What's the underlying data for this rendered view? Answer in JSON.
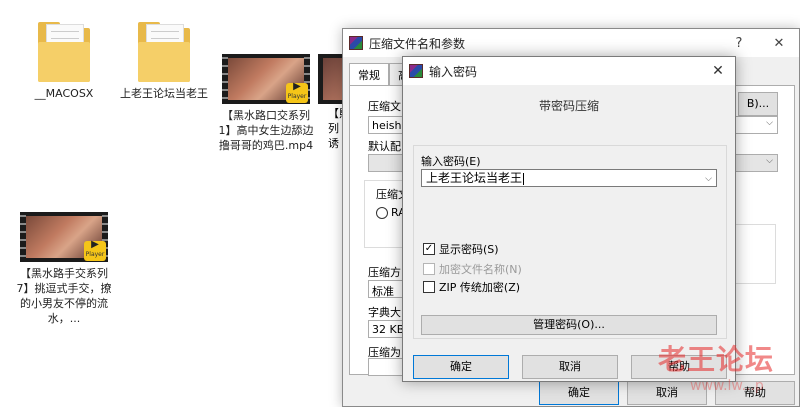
{
  "desktop": {
    "files": [
      {
        "type": "folder",
        "label": "__MACOSX"
      },
      {
        "type": "folder",
        "label": "上老王论坛当老王"
      },
      {
        "type": "video",
        "label": "【黑水路口交系列1】高中女生边舔边撸哥哥的鸡巴.mp4"
      },
      {
        "type": "video",
        "label": "【黑水路手交系列7】挑逗式手交，撩的小男友不停的流水，..."
      }
    ],
    "badge_text": "Player",
    "partial_labels": [
      "【熙",
      "列",
      "诱"
    ]
  },
  "archive_dialog": {
    "title": "压缩文件名和参数",
    "help_symbol": "?",
    "close_symbol": "✕",
    "tabs": [
      "常规",
      "高"
    ],
    "archive_name_label": "压缩文",
    "browse_button": "B)...",
    "archive_name_value": "heishu",
    "profile_label": "默认配",
    "format_label": "压缩文",
    "format_option": "RA",
    "method_label": "压缩方",
    "method_value": "标准",
    "dict_label": "字典大",
    "dict_value": "32 KB",
    "split_label": "压缩为",
    "ok_button": "确定",
    "cancel_button": "取消",
    "help_button": "帮助"
  },
  "password_dialog": {
    "title": "输入密码",
    "close_symbol": "✕",
    "heading": "带密码压缩",
    "password_label": "输入密码(E)",
    "password_value": "上老王论坛当老王",
    "show_password": {
      "label": "显示密码(S)",
      "checked": true
    },
    "encrypt_names": {
      "label": "加密文件名称(N)",
      "checked": false,
      "disabled": true
    },
    "zip_legacy": {
      "label": "ZIP 传统加密(Z)",
      "checked": false
    },
    "manage_button": "管理密码(O)...",
    "ok_button": "确定",
    "cancel_button": "取消",
    "help_button": "帮助"
  },
  "watermark": {
    "text": "老王论坛",
    "subtext": "www.lw...p"
  }
}
